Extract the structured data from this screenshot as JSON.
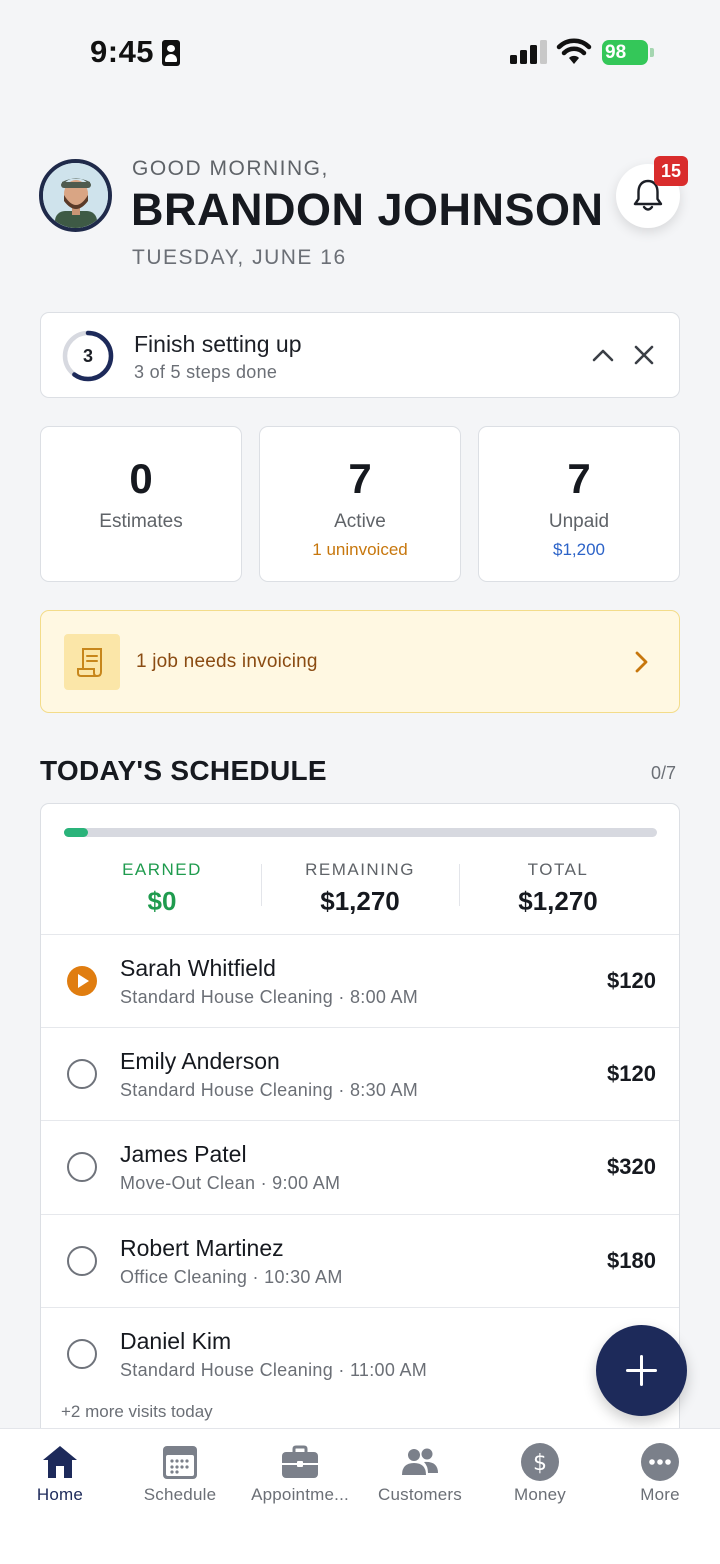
{
  "status_bar": {
    "time": "9:45",
    "battery": "98"
  },
  "header": {
    "greeting": "GOOD MORNING,",
    "name": "BRANDON JOHNSON",
    "date": "TUESDAY, JUNE 16",
    "notification_count": "15"
  },
  "setup": {
    "step_number": "3",
    "title": "Finish setting up",
    "subtitle": "3 of 5 steps done",
    "completed_fraction": 0.6
  },
  "stats": [
    {
      "value": "0",
      "label": "Estimates",
      "sub": ""
    },
    {
      "value": "7",
      "label": "Active",
      "sub": "1 uninvoiced"
    },
    {
      "value": "7",
      "label": "Unpaid",
      "sub": "$1,200"
    }
  ],
  "invoice_alert": {
    "text": "1 job needs invoicing"
  },
  "schedule": {
    "title": "TODAY'S SCHEDULE",
    "count": "0/7",
    "progress_fraction": 0.04,
    "summary": {
      "earned_label": "EARNED",
      "earned_value": "$0",
      "remaining_label": "REMAINING",
      "remaining_value": "$1,270",
      "total_label": "TOTAL",
      "total_value": "$1,270"
    },
    "visits": [
      {
        "name": "Sarah Whitfield",
        "service": "Standard House Cleaning",
        "time": "8:00 AM",
        "amount": "$120",
        "status": "in-progress"
      },
      {
        "name": "Emily Anderson",
        "service": "Standard House Cleaning",
        "time": "8:30 AM",
        "amount": "$120",
        "status": "pending"
      },
      {
        "name": "James Patel",
        "service": "Move-Out Clean",
        "time": "9:00 AM",
        "amount": "$320",
        "status": "pending"
      },
      {
        "name": "Robert Martinez",
        "service": "Office Cleaning",
        "time": "10:30 AM",
        "amount": "$180",
        "status": "pending"
      },
      {
        "name": "Daniel Kim",
        "service": "Standard House Cleaning",
        "time": "11:00 AM",
        "amount": "",
        "status": "pending"
      }
    ],
    "more_text": "+2 more visits today"
  },
  "nav": [
    {
      "label": "Home",
      "icon": "home-icon",
      "active": true
    },
    {
      "label": "Schedule",
      "icon": "calendar-icon",
      "active": false
    },
    {
      "label": "Appointme...",
      "icon": "briefcase-icon",
      "active": false
    },
    {
      "label": "Customers",
      "icon": "people-icon",
      "active": false
    },
    {
      "label": "Money",
      "icon": "dollar-icon",
      "active": false
    },
    {
      "label": "More",
      "icon": "more-icon",
      "active": false
    }
  ],
  "colors": {
    "navy": "#1d2a5a",
    "accent_orange": "#e07d10",
    "earned_green": "#1f9b4e",
    "alert_bg": "#fff8e2",
    "badge_red": "#d92c2c"
  }
}
